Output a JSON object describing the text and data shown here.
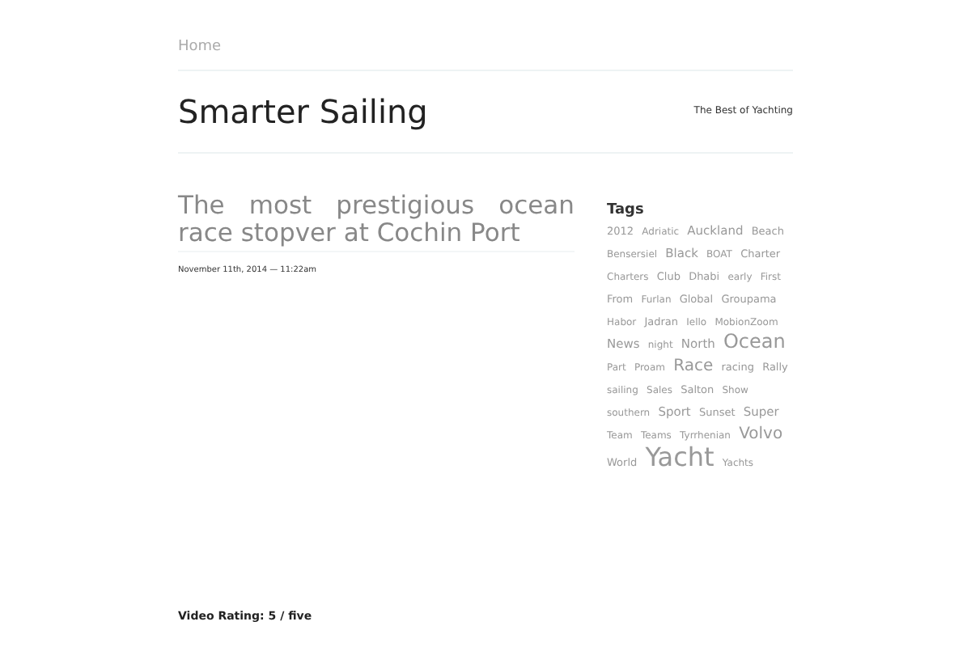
{
  "nav": [
    {
      "label": "Home",
      "selected": false
    }
  ],
  "site": {
    "title": "Smarter Sailing",
    "tagline": "The Best of Yachting"
  },
  "post": {
    "title": "The most prestigious ocean race stopver at Cochin Port",
    "date": "November 11th, 2014 — 11:22am",
    "rating": "Video Rating: 5 / five"
  },
  "sidebar": {
    "heading": "Tags",
    "tags": [
      {
        "label": "2012",
        "kind": "s"
      },
      {
        "label": "Adriatic",
        "kind": "xs"
      },
      {
        "label": "Auckland",
        "kind": "m"
      },
      {
        "label": "Beach",
        "kind": "s"
      },
      {
        "label": "Bensersiel",
        "kind": "xs"
      },
      {
        "label": "Black",
        "kind": "m"
      },
      {
        "label": "BOAT",
        "kind": "xs"
      },
      {
        "label": "Charter",
        "kind": "s"
      },
      {
        "label": "Charters",
        "kind": "xs"
      },
      {
        "label": "Club",
        "kind": "s"
      },
      {
        "label": "Dhabi",
        "kind": "s"
      },
      {
        "label": "early",
        "kind": "xs"
      },
      {
        "label": "First",
        "kind": "xs"
      },
      {
        "label": "From",
        "kind": "s"
      },
      {
        "label": "Furlan",
        "kind": "xs"
      },
      {
        "label": "Global",
        "kind": "s"
      },
      {
        "label": "Groupama",
        "kind": "s"
      },
      {
        "label": "Habor",
        "kind": "xs"
      },
      {
        "label": "Jadran",
        "kind": "s"
      },
      {
        "label": "Iello",
        "kind": "xs"
      },
      {
        "label": "MobionZoom",
        "kind": "xs"
      },
      {
        "label": "News",
        "kind": "m"
      },
      {
        "label": "night",
        "kind": "xs"
      },
      {
        "label": "North",
        "kind": "m"
      },
      {
        "label": "Ocean",
        "kind": "xl"
      },
      {
        "label": "Part",
        "kind": "xs"
      },
      {
        "label": "Proam",
        "kind": "xs"
      },
      {
        "label": "Race",
        "kind": "l"
      },
      {
        "label": "racing",
        "kind": "s"
      },
      {
        "label": "Rally",
        "kind": "s"
      },
      {
        "label": "sailing",
        "kind": "xs"
      },
      {
        "label": "Sales",
        "kind": "xs"
      },
      {
        "label": "Salton",
        "kind": "s"
      },
      {
        "label": "Show",
        "kind": "xs"
      },
      {
        "label": "southern",
        "kind": "xs"
      },
      {
        "label": "Sport",
        "kind": "m"
      },
      {
        "label": "Sunset",
        "kind": "s"
      },
      {
        "label": "Super",
        "kind": "m"
      },
      {
        "label": "Team",
        "kind": "xs"
      },
      {
        "label": "Teams",
        "kind": "xs"
      },
      {
        "label": "Tyrrhenian",
        "kind": "xs"
      },
      {
        "label": "Volvo",
        "kind": "l"
      },
      {
        "label": "World",
        "kind": "s"
      },
      {
        "label": "Yacht",
        "kind": "xxl"
      },
      {
        "label": "Yachts",
        "kind": "xs"
      }
    ]
  }
}
